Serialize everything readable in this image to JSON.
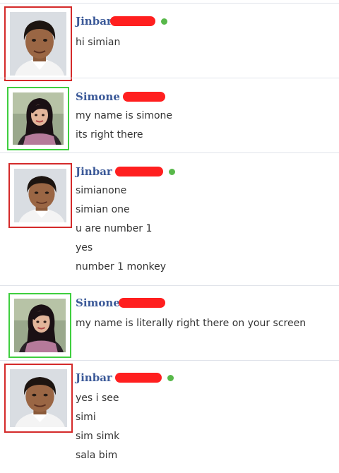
{
  "messages": [
    {
      "sender": "Jinbar",
      "online": true,
      "avatar": "male-profile-photo",
      "frame_color": "#d42a2a",
      "lines": [
        "hi simian"
      ]
    },
    {
      "sender": "Simone",
      "online": false,
      "avatar": "female-profile-photo",
      "frame_color": "#3fcf3f",
      "lines": [
        "my name is simone",
        "its right there"
      ]
    },
    {
      "sender": "Jinbar",
      "online": true,
      "avatar": "male-profile-photo",
      "frame_color": "#d42a2a",
      "lines": [
        "simianone",
        "simian one",
        "u are number 1",
        "yes",
        "number 1 monkey"
      ]
    },
    {
      "sender": "Simone",
      "online": false,
      "avatar": "female-profile-photo",
      "frame_color": "#3fcf3f",
      "lines": [
        "my name is literally right there on your screen"
      ]
    },
    {
      "sender": "Jinbar",
      "online": true,
      "avatar": "male-profile-photo",
      "frame_color": "#d42a2a",
      "lines": [
        "yes i see",
        "simi",
        "sim simk",
        "sala bim"
      ]
    }
  ],
  "colors": {
    "name_link": "#3b5998",
    "redaction": "#ff1f1f",
    "online": "#58b84a",
    "text": "#333333"
  }
}
